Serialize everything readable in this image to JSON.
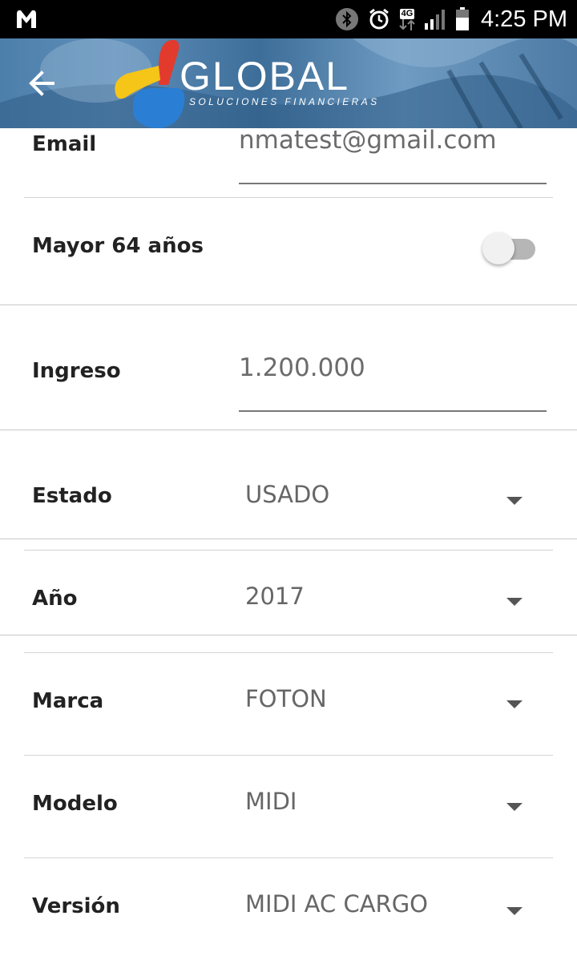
{
  "status_bar": {
    "time": "4:25 PM",
    "network": "4G",
    "icons": [
      "malwarebytes-icon",
      "bluetooth-icon",
      "alarm-icon",
      "network-4g-icon",
      "signal-icon",
      "battery-icon"
    ]
  },
  "header": {
    "back_icon": "arrow-left-icon",
    "logo_title": "GLOBAL",
    "logo_subtitle": "SOLUCIONES FINANCIERAS",
    "colors": {
      "logo_red": "#e23b2e",
      "logo_yellow": "#f5c518",
      "logo_blue": "#2a7fd4"
    }
  },
  "form": {
    "email": {
      "label": "Email",
      "value": "nmatest@gmail.com"
    },
    "mayor": {
      "label": "Mayor 64 años",
      "checked": false
    },
    "ingreso": {
      "label": "Ingreso",
      "value": "1.200.000"
    },
    "estado": {
      "label": "Estado",
      "value": "USADO"
    },
    "anio": {
      "label": "Año",
      "value": "2017"
    },
    "marca": {
      "label": "Marca",
      "value": "FOTON"
    },
    "modelo": {
      "label": "Modelo",
      "value": "MIDI"
    },
    "version": {
      "label": "Versión",
      "value": "MIDI AC CARGO"
    }
  }
}
